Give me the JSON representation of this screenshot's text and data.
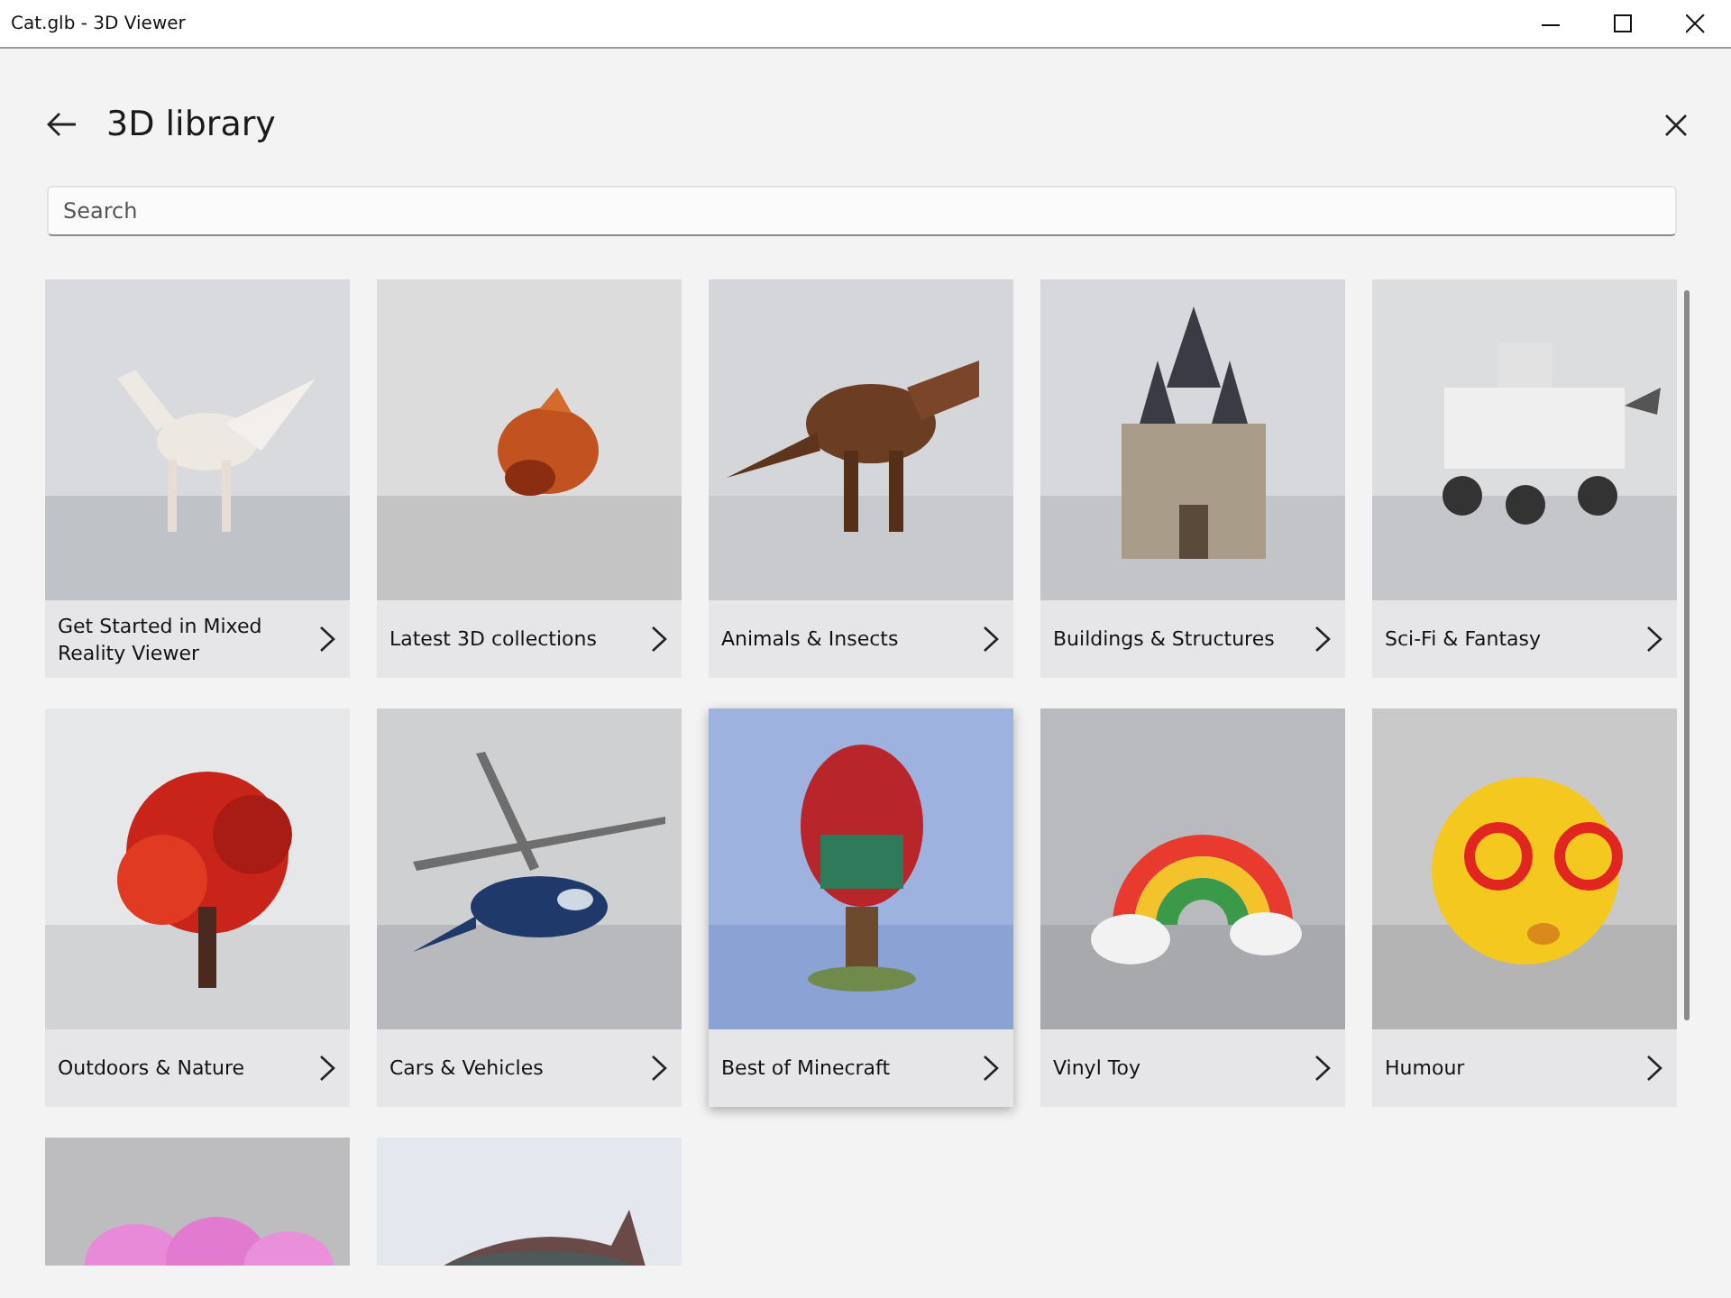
{
  "window": {
    "title": "Cat.glb - 3D Viewer"
  },
  "header": {
    "title": "3D library"
  },
  "search": {
    "placeholder": "Search"
  },
  "cards": [
    {
      "label": "Get Started in Mixed Reality Viewer",
      "hovered": false
    },
    {
      "label": "Latest 3D collections",
      "hovered": false
    },
    {
      "label": "Animals & Insects",
      "hovered": false
    },
    {
      "label": "Buildings & Structures",
      "hovered": false
    },
    {
      "label": "Sci-Fi & Fantasy",
      "hovered": false
    },
    {
      "label": "Outdoors & Nature",
      "hovered": false
    },
    {
      "label": "Cars & Vehicles",
      "hovered": false
    },
    {
      "label": "Best of Minecraft",
      "hovered": true
    },
    {
      "label": "Vinyl Toy",
      "hovered": false
    },
    {
      "label": "Humour",
      "hovered": false
    },
    {
      "hovered": false
    },
    {
      "hovered": false
    }
  ]
}
